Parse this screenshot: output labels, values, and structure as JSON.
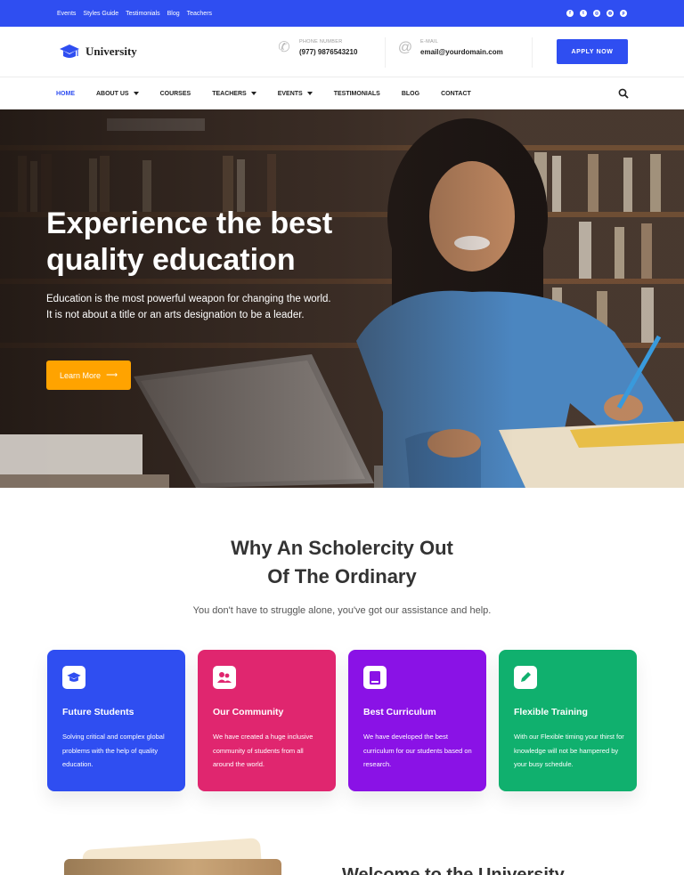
{
  "topbar": {
    "links": [
      "Events",
      "Styles Guide",
      "Testimonials",
      "Blog",
      "Teachers"
    ],
    "social_icons": [
      "facebook-icon",
      "twitter-icon",
      "instagram-icon",
      "dribbble-icon",
      "pinterest-icon"
    ]
  },
  "header": {
    "logo_text": "University",
    "phone_label": "PHONE NUMBER",
    "phone_value": "(977) 9876543210",
    "email_label": "E-MAIL",
    "email_value": "email@yourdomain.com",
    "apply_label": "APPLY NOW"
  },
  "nav": {
    "items": [
      {
        "label": "HOME",
        "active": true,
        "dropdown": false
      },
      {
        "label": "ABOUT US",
        "active": false,
        "dropdown": true
      },
      {
        "label": "COURSES",
        "active": false,
        "dropdown": false
      },
      {
        "label": "TEACHERS",
        "active": false,
        "dropdown": true
      },
      {
        "label": "EVENTS",
        "active": false,
        "dropdown": true
      },
      {
        "label": "TESTIMONIALS",
        "active": false,
        "dropdown": false
      },
      {
        "label": "BLOG",
        "active": false,
        "dropdown": false
      },
      {
        "label": "CONTACT",
        "active": false,
        "dropdown": false
      }
    ]
  },
  "hero": {
    "title_line1": "Experience the best",
    "title_line2": "quality education",
    "text": "Education is the most powerful weapon for changing the world. It is not about a title or an arts designation to be a leader.",
    "button_label": "Learn More"
  },
  "why": {
    "title_line1": "Why An Scholercity Out",
    "title_line2": "Of The Ordinary",
    "subtitle": "You don't have to struggle alone, you've got our assistance and help."
  },
  "cards": [
    {
      "title": "Future Students",
      "text": "Solving critical and complex global problems with the help of quality education.",
      "color": "#2f4ef1",
      "icon": "graduation-cap-icon"
    },
    {
      "title": "Our Community",
      "text": "We have created a huge inclusive community of students from all around the world.",
      "color": "#e0266f",
      "icon": "community-icon"
    },
    {
      "title": "Best Curriculum",
      "text": "We have developed the best curriculum for our students based on research.",
      "color": "#8a12e6",
      "icon": "book-icon"
    },
    {
      "title": "Flexible Training",
      "text": "With our Flexible timing your thirst for knowledge will not be hampered by your busy schedule.",
      "color": "#10b06e",
      "icon": "pencil-icon"
    }
  ],
  "welcome": {
    "title": "Welcome to the University"
  },
  "colors": {
    "primary": "#2f4ef1",
    "accent": "#ffa300"
  }
}
